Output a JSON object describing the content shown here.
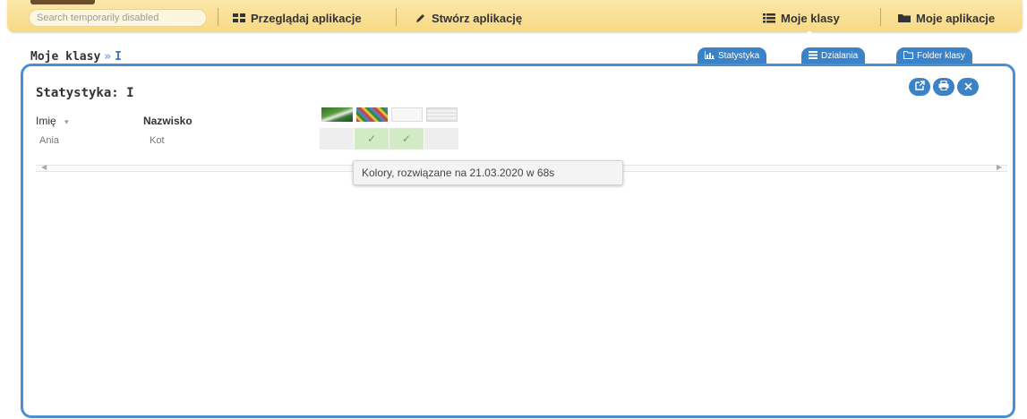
{
  "nav": {
    "search_placeholder": "Search temporarily disabled",
    "browse_label": "Przeglądaj aplikacje",
    "create_label": "Stwórz aplikację",
    "my_classes_label": "Moje klasy",
    "my_apps_label": "Moje aplikacje"
  },
  "breadcrumb": {
    "root": "Moje klasy",
    "separator": "»",
    "current": "I"
  },
  "tabs": [
    {
      "label": "Statystyka",
      "icon": "bar-chart-icon"
    },
    {
      "label": "Dzialania",
      "icon": "list-icon"
    },
    {
      "label": "Folder klasy",
      "icon": "folder-icon"
    }
  ],
  "panel": {
    "title": "Statystyka: I",
    "buttons": [
      "external-link-icon",
      "print-icon",
      "close-icon"
    ]
  },
  "table": {
    "columns": {
      "first_name": "Imię",
      "sort_indicator": "▾",
      "last_name": "Nazwisko"
    },
    "apps": [
      "app-thumbnail-1",
      "app-thumbnail-2",
      "app-thumbnail-3",
      "app-thumbnail-4"
    ],
    "rows": [
      {
        "first_name": "Ania",
        "last_name": "Kot",
        "results": [
          "",
          "✓",
          "✓",
          ""
        ]
      }
    ]
  },
  "tooltip": {
    "text": "Kolory, rozwiązane na 21.03.2020 w 68s"
  },
  "colors": {
    "accent": "#3b82c6",
    "nav_bg": "#f7d985",
    "solved_cell": "#d3eac6",
    "check": "#6aa84f"
  }
}
